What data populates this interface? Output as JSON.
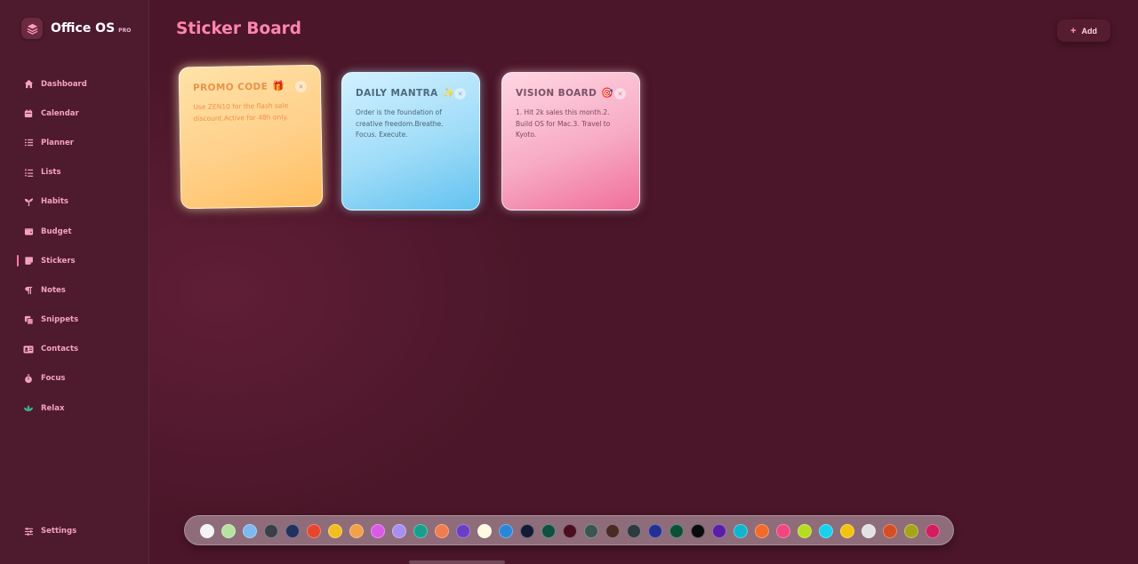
{
  "app": {
    "name": "Office OS",
    "badge": "PRO"
  },
  "sidebar": {
    "items": [
      {
        "label": "Dashboard",
        "icon": "home-icon"
      },
      {
        "label": "Calendar",
        "icon": "calendar-icon"
      },
      {
        "label": "Planner",
        "icon": "planner-icon"
      },
      {
        "label": "Lists",
        "icon": "list-icon"
      },
      {
        "label": "Habits",
        "icon": "sprout-icon"
      },
      {
        "label": "Budget",
        "icon": "wallet-icon"
      },
      {
        "label": "Stickers",
        "icon": "sticker-icon",
        "active": true
      },
      {
        "label": "Notes",
        "icon": "paragraph-icon"
      },
      {
        "label": "Snippets",
        "icon": "copy-icon"
      },
      {
        "label": "Contacts",
        "icon": "contact-card-icon"
      },
      {
        "label": "Focus",
        "icon": "timer-icon"
      },
      {
        "label": "Relax",
        "icon": "lotus-icon"
      }
    ],
    "settings_label": "Settings"
  },
  "header": {
    "title": "Sticker Board",
    "add_label": "Add"
  },
  "stickers": [
    {
      "title": "PROMO CODE",
      "emoji": "🎁",
      "text": "Use ZEN10 for the flash sale discount.Active for 48h only.",
      "color": "#ffd08a"
    },
    {
      "title": "DAILY MANTRA",
      "emoji": "✨",
      "text": "Order is the foundation of creative freedom.Breathe. Focus. Execute.",
      "color": "#9fdcf8"
    },
    {
      "title": "VISION BOARD",
      "emoji": "🎯",
      "text": "1. Hit 2k sales this month.2. Build OS for Mac.3. Travel to Kyoto.",
      "color": "#f7abc4"
    }
  ],
  "palette": [
    "#f4f4f6",
    "#b6e3a0",
    "#7db8f0",
    "#3a3f48",
    "#23305e",
    "#e6452e",
    "#f2be1e",
    "#f2a04a",
    "#da5ae8",
    "#a88ef0",
    "#14a08c",
    "#f07c50",
    "#6a3ec4",
    "#fff8e2",
    "#2c86d8",
    "#131a33",
    "#0f5040",
    "#4a0e1e",
    "#3b5551",
    "#4a2a22",
    "#2d3a40",
    "#243092",
    "#0c5038",
    "#0a0a0a",
    "#5a1ea6",
    "#10b4cc",
    "#f26a28",
    "#f0457e",
    "#b6dc20",
    "#16d2ee",
    "#f2c40e",
    "#e2e2e2",
    "#d44e24",
    "#a6a418",
    "#d21e5e"
  ]
}
